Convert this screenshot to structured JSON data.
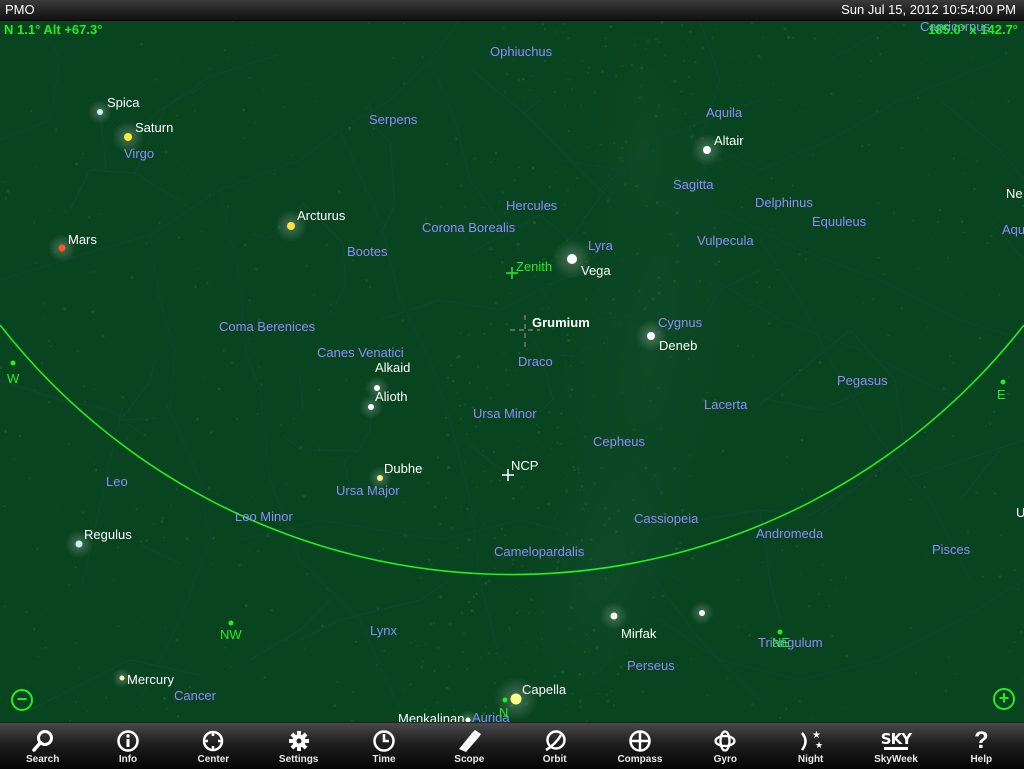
{
  "status_bar": {
    "carrier": "PMO",
    "datetime": "Sun Jul 15, 2012  10:54:00 PM"
  },
  "readouts": {
    "position": "N 1.1° Alt +67.3°",
    "field_of_view": "185.0° x 142.7°"
  },
  "colors": {
    "constellation_label": "#8c8cff",
    "star_label": "#ffffff",
    "direction_label": "#22ee22",
    "horizon_line": "#22ee22",
    "ground": "#0a4a23",
    "constellation_lines": "#5a1fa8"
  },
  "sky": {
    "constellations": [
      {
        "name": "Capricornus"
      },
      {
        "name": "Ophiuchus"
      },
      {
        "name": "Aquila"
      },
      {
        "name": "Serpens"
      },
      {
        "name": "Virgo"
      },
      {
        "name": "Sagitta"
      },
      {
        "name": "Hercules"
      },
      {
        "name": "Delphinus"
      },
      {
        "name": "Equuleus"
      },
      {
        "name": "Corona Borealis"
      },
      {
        "name": "Bootes"
      },
      {
        "name": "Lyra"
      },
      {
        "name": "Vulpecula"
      },
      {
        "name": "Coma Berenices"
      },
      {
        "name": "Cygnus"
      },
      {
        "name": "Canes Venatici"
      },
      {
        "name": "Draco"
      },
      {
        "name": "Pegasus"
      },
      {
        "name": "Ursa Minor"
      },
      {
        "name": "Lacerta"
      },
      {
        "name": "Cepheus"
      },
      {
        "name": "Leo"
      },
      {
        "name": "Ursa Major"
      },
      {
        "name": "Leo Minor"
      },
      {
        "name": "Cassiopeia"
      },
      {
        "name": "Andromeda"
      },
      {
        "name": "Camelopardalis"
      },
      {
        "name": "Pisces"
      },
      {
        "name": "Lynx"
      },
      {
        "name": "Triangulum"
      },
      {
        "name": "Perseus"
      },
      {
        "name": "Cancer"
      },
      {
        "name": "Auriga"
      },
      {
        "name": "Aqu"
      }
    ],
    "stars": [
      {
        "name": "Spica"
      },
      {
        "name": "Saturn"
      },
      {
        "name": "Altair"
      },
      {
        "name": "Arcturus"
      },
      {
        "name": "Mars"
      },
      {
        "name": "Vega"
      },
      {
        "name": "Grumium"
      },
      {
        "name": "Deneb"
      },
      {
        "name": "Alkaid"
      },
      {
        "name": "Alioth"
      },
      {
        "name": "Dubhe"
      },
      {
        "name": "NCP"
      },
      {
        "name": "Regulus"
      },
      {
        "name": "Mirfak"
      },
      {
        "name": "Mercury"
      },
      {
        "name": "Capella"
      },
      {
        "name": "Menkalinan"
      },
      {
        "name": "Ne"
      },
      {
        "name": "U"
      }
    ],
    "markers": {
      "zenith": "Zenith",
      "west": "W",
      "northwest": "NW",
      "north": "N",
      "northeast": "NE",
      "east": "E"
    },
    "zoom_out_icon": "minus-circle-icon",
    "zoom_in_icon": "plus-circle-icon"
  },
  "toolbar": [
    {
      "label": "Search",
      "icon": "search-icon"
    },
    {
      "label": "Info",
      "icon": "info-icon"
    },
    {
      "label": "Center",
      "icon": "crosshair-icon"
    },
    {
      "label": "Settings",
      "icon": "gear-icon"
    },
    {
      "label": "Time",
      "icon": "clock-icon"
    },
    {
      "label": "Scope",
      "icon": "telescope-icon"
    },
    {
      "label": "Orbit",
      "icon": "orbit-icon"
    },
    {
      "label": "Compass",
      "icon": "compass-icon"
    },
    {
      "label": "Gyro",
      "icon": "gyro-icon"
    },
    {
      "label": "Night",
      "icon": "moon-stars-icon"
    },
    {
      "label": "SkyWeek",
      "icon": "sky-telescope-logo-icon",
      "logo_text": "SKY"
    },
    {
      "label": "Help",
      "icon": "help-icon"
    }
  ]
}
